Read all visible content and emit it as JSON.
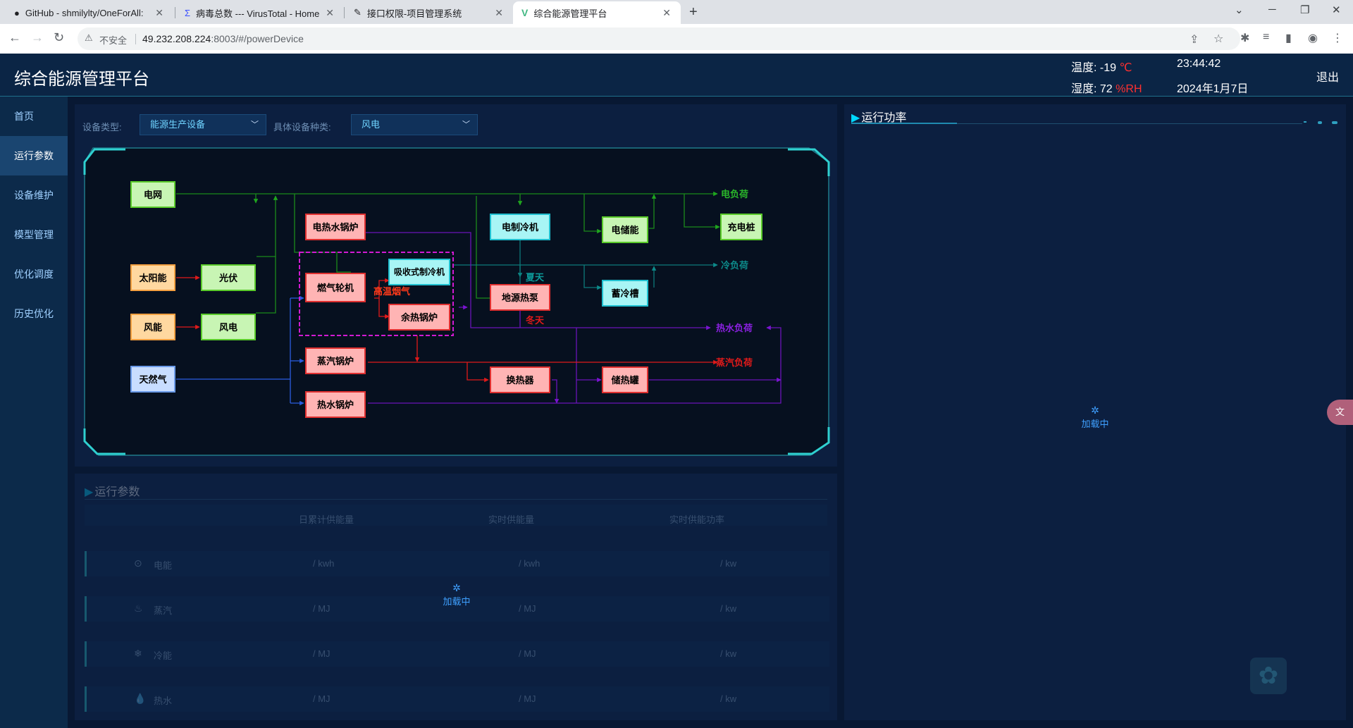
{
  "browser": {
    "tabs": [
      {
        "title": "GitHub - shmilylty/OneForAll:",
        "icon": "github-icon",
        "active": false
      },
      {
        "title": "病毒总数 --- VirusTotal - Home",
        "icon": "virustotal-icon",
        "active": false
      },
      {
        "title": "接口权限-项目管理系统",
        "icon": "pen-icon",
        "active": false
      },
      {
        "title": "综合能源管理平台",
        "icon": "vue-icon",
        "active": true
      }
    ],
    "address": {
      "insecure_label": "不安全",
      "url_host": "49.232.208.224",
      "url_rest": ":8003/#/powerDevice"
    }
  },
  "header": {
    "title": "综合能源管理平台",
    "temp_label": "温度:",
    "temp_value": "-19",
    "temp_unit": "℃",
    "hum_label": "湿度:",
    "hum_value": "72",
    "hum_unit": "%RH",
    "time": "23:44:42",
    "date": "2024年1月7日",
    "logout": "退出"
  },
  "sidebar": {
    "items": [
      {
        "label": "首页",
        "active": false
      },
      {
        "label": "运行参数",
        "active": true
      },
      {
        "label": "设备维护",
        "active": false
      },
      {
        "label": "模型管理",
        "active": false
      },
      {
        "label": "优化调度",
        "active": false
      },
      {
        "label": "历史优化",
        "active": false
      }
    ]
  },
  "filters": {
    "device_type_label": "设备类型:",
    "device_type_value": "能源生产设备",
    "device_kind_label": "具体设备种类:",
    "device_kind_value": "风电"
  },
  "diagram": {
    "nodes": {
      "grid": "电网",
      "solar": "太阳能",
      "pv": "光伏",
      "wind": "风能",
      "wind_power": "风电",
      "gas": "天然气",
      "elec_boiler": "电热水锅炉",
      "gas_turbine": "燃气轮机",
      "absorption": "吸收式制冷机",
      "waste_heat": "余热锅炉",
      "steam_boiler": "蒸汽锅炉",
      "hot_boiler": "热水锅炉",
      "elec_chiller": "电制冷机",
      "heat_pump": "地源热泵",
      "exchanger": "换热器",
      "elec_storage": "电储能",
      "cold_storage": "蓄冷槽",
      "heat_storage": "储热罐",
      "charger": "充电桩"
    },
    "labels": {
      "elec_load": "电负荷",
      "cold_load": "冷负荷",
      "hot_water_load": "热水负荷",
      "steam_load": "蒸汽负荷",
      "flue_gas": "高温烟气",
      "summer": "夏天",
      "winter": "冬天"
    }
  },
  "run_params": {
    "title": "运行参数",
    "columns": [
      "日累计供能量",
      "实时供能量",
      "实时供能功率"
    ],
    "rows": [
      {
        "name": "电能",
        "icon": "electric-icon",
        "units": [
          "/ kwh",
          "/ kwh",
          "/ kw"
        ]
      },
      {
        "name": "蒸汽",
        "icon": "steam-icon",
        "units": [
          "/ MJ",
          "/ MJ",
          "/ kw"
        ]
      },
      {
        "name": "冷能",
        "icon": "cold-icon",
        "units": [
          "/ MJ",
          "/ MJ",
          "/ kw"
        ]
      },
      {
        "name": "热水",
        "icon": "water-icon",
        "units": [
          "/ MJ",
          "/ MJ",
          "/ kw"
        ]
      }
    ],
    "loading": "加载中"
  },
  "power_panel": {
    "title": "运行功率",
    "loading": "加载中"
  },
  "floating": {
    "translate_icon": "translate-icon",
    "logo_icon": "fan-logo-icon"
  }
}
